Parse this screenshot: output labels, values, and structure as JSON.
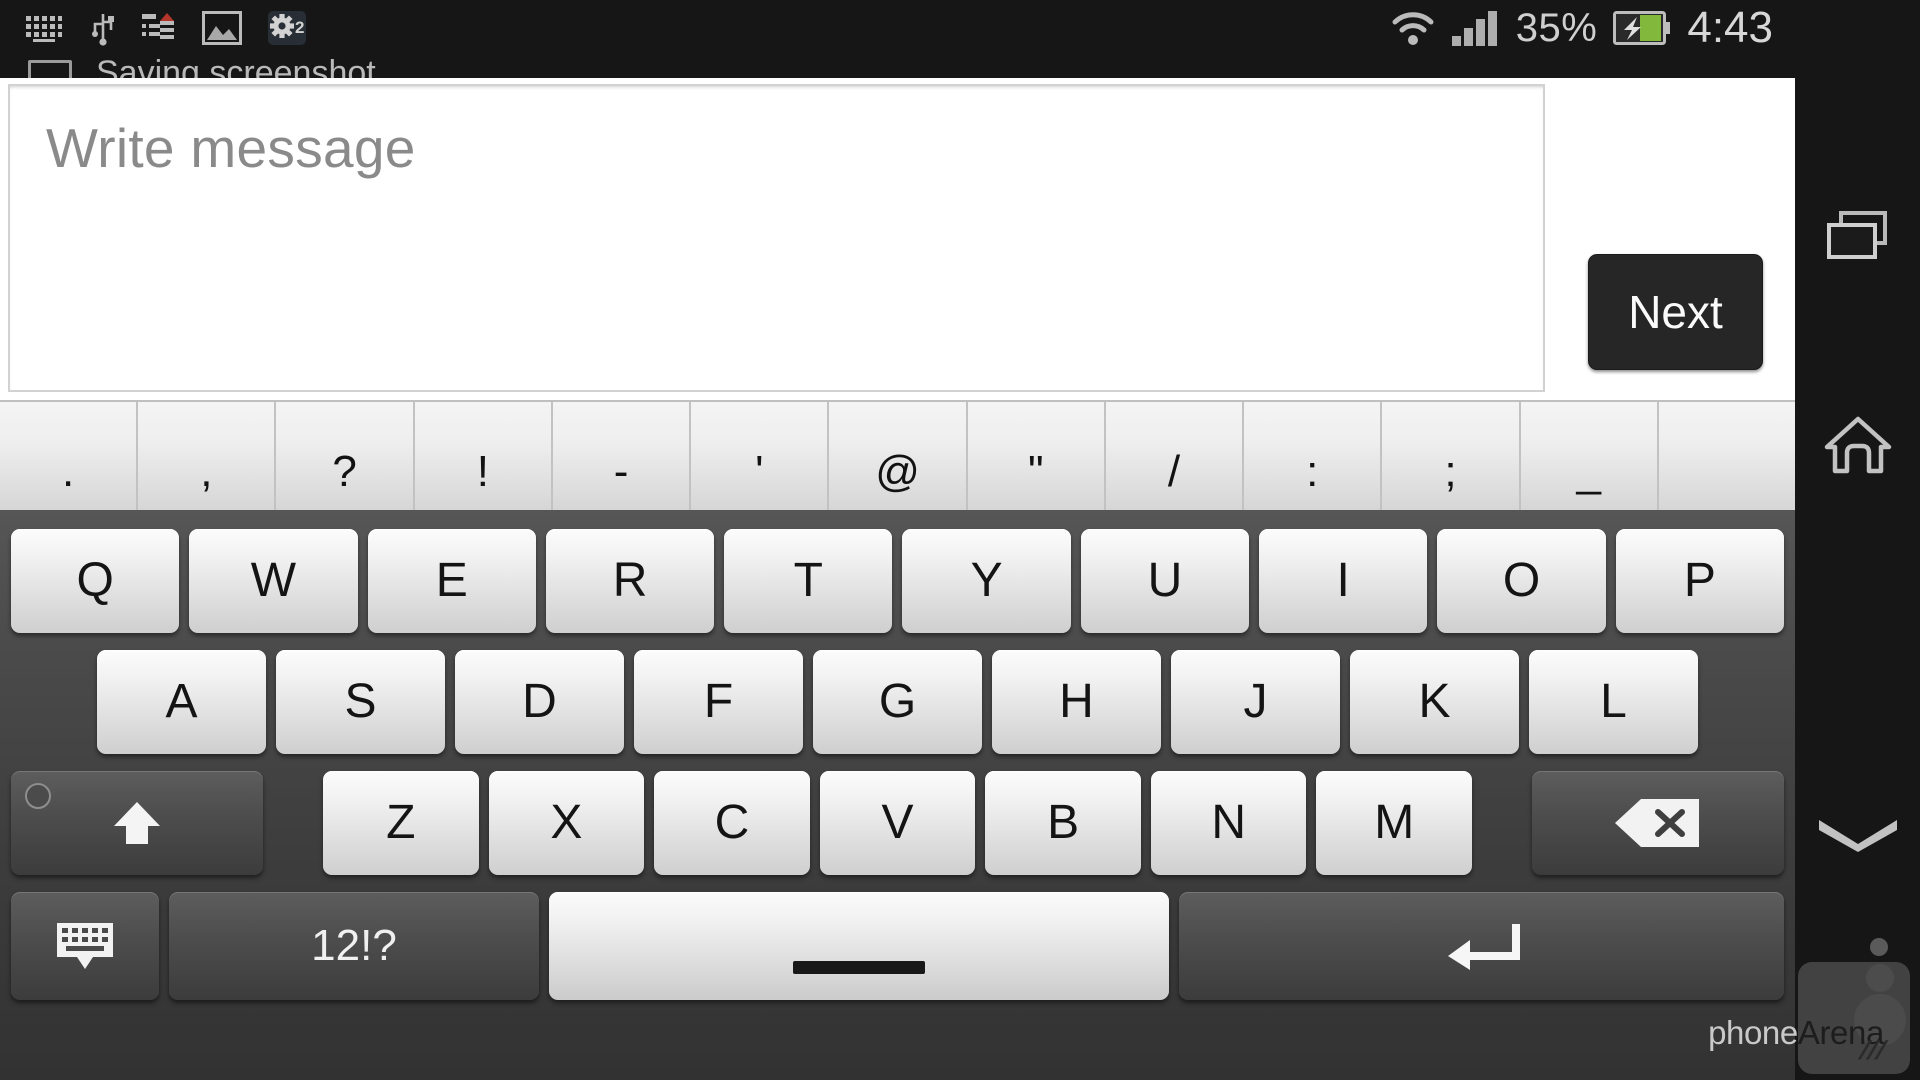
{
  "status_bar": {
    "left_icons": [
      "keyboard-icon",
      "usb-icon",
      "list-upload-icon",
      "image-icon",
      "settings-sync-icon"
    ],
    "wifi_icon": "wifi-icon",
    "signal_icon": "cellular-signal-icon",
    "battery_percent": "35%",
    "battery_icon": "battery-charging-icon",
    "time": "4:43"
  },
  "notification": {
    "icon": "screenshot-icon",
    "text": "Saving screenshot..."
  },
  "compose": {
    "placeholder": "Write message",
    "value": "",
    "next_label": "Next"
  },
  "punctuation_row": [
    {
      "label": ".",
      "name": "period"
    },
    {
      "label": ",",
      "name": "comma"
    },
    {
      "label": "?",
      "name": "question-mark"
    },
    {
      "label": "!",
      "name": "exclamation-mark"
    },
    {
      "label": "-",
      "name": "hyphen"
    },
    {
      "label": "'",
      "name": "apostrophe"
    },
    {
      "label": "@",
      "name": "at-sign"
    },
    {
      "label": "\"",
      "name": "double-quote"
    },
    {
      "label": "/",
      "name": "slash"
    },
    {
      "label": ":",
      "name": "colon"
    },
    {
      "label": ";",
      "name": "semicolon"
    },
    {
      "label": "_",
      "name": "underscore"
    },
    {
      "label": "",
      "name": "blank"
    }
  ],
  "keyboard": {
    "row1": [
      "Q",
      "W",
      "E",
      "R",
      "T",
      "Y",
      "U",
      "I",
      "O",
      "P"
    ],
    "row2": [
      "A",
      "S",
      "D",
      "F",
      "G",
      "H",
      "J",
      "K",
      "L"
    ],
    "row3": [
      "Z",
      "X",
      "C",
      "V",
      "B",
      "N",
      "M"
    ],
    "shift_icon": "shift-arrow-up-icon",
    "backspace_icon": "backspace-icon",
    "hide_keyboard_icon": "hide-keyboard-icon",
    "symbols_label": "12!?",
    "space_label": "",
    "enter_icon": "enter-return-icon"
  },
  "navbar": {
    "recent_apps_icon": "recent-apps-icon",
    "home_icon": "home-icon",
    "back_icon": "chevron-down-icon"
  },
  "watermark": {
    "text_light": "phone",
    "text_dark": "Arena"
  },
  "colors": {
    "status_bar_bg": "#161616",
    "compose_bg": "#ffffff",
    "next_button_bg": "#262626",
    "keyboard_bg": "#3d3d3d",
    "key_light": "#eeeeee",
    "key_dark": "#4e4e4e",
    "battery_green": "#8cc63f"
  }
}
